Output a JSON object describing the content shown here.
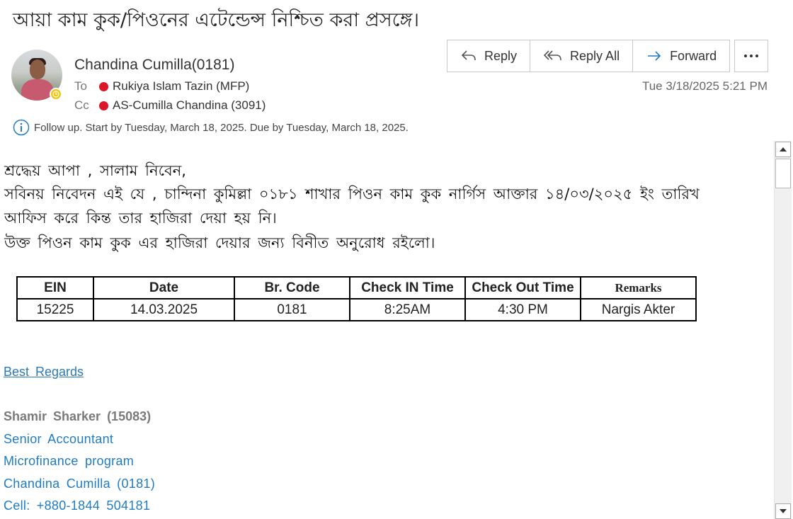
{
  "subject": "আয়া কাম কুক/পিওনের এটেন্ডেন্স নিশ্চিত করা প্রসঙ্গে।",
  "sender": {
    "name": "Chandina Cumilla(0181)"
  },
  "to": {
    "label": "To",
    "recipient": "Rukiya Islam Tazin (MFP)"
  },
  "cc": {
    "label": "Cc",
    "recipient": "AS-Cumilla Chandina (3091)"
  },
  "toolbar": {
    "reply": "Reply",
    "reply_all": "Reply All",
    "forward": "Forward"
  },
  "timestamp": "Tue 3/18/2025 5:21 PM",
  "followup": "Follow up.  Start by Tuesday, March 18, 2025.  Due by Tuesday, March 18, 2025.",
  "body": {
    "greeting": "শ্রদ্ধেয় আপা , সালাম নিবেন,",
    "line1": "সবিনয় নিবেদন এই যে , চান্দিনা কুমিল্লা ০১৮১ শাখার পিওন কাম কুক নার্গিস আক্তার ১৪/০৩/২০২৫ ইং তারিখ",
    "line2": "আফিস করে কিন্ত তার হাজিরা দেয়া হয় নি।",
    "line3": "উক্ত পিওন কাম কুক এর হাজিরা  দেয়ার জন্য বিনীত অনুরোধ রইলো।"
  },
  "table": {
    "headers": [
      "EIN",
      "Date",
      "Br. Code",
      "Check IN Time",
      "Check Out Time",
      "Remarks"
    ],
    "rows": [
      [
        "15225",
        "14.03.2025",
        "0181",
        "8:25AM",
        "4:30 PM",
        "Nargis Akter"
      ]
    ]
  },
  "signature": {
    "closing": "Best  Regards",
    "name": "Shamir Sharker (15083)",
    "title": "Senior  Accountant",
    "program": "Microfinance  program",
    "branch": "Chandina  Cumilla  (0181)",
    "cell": "Cell:  +880-1844  504181"
  },
  "colors": {
    "link": "#2c7ab3",
    "signature_blue": "#1f7cc4",
    "presence": "#f2c511",
    "recipient_dot": "#d9162a"
  },
  "icons": [
    "reply-icon",
    "reply-all-icon",
    "forward-icon",
    "more-icon",
    "info-icon",
    "clock-icon"
  ]
}
